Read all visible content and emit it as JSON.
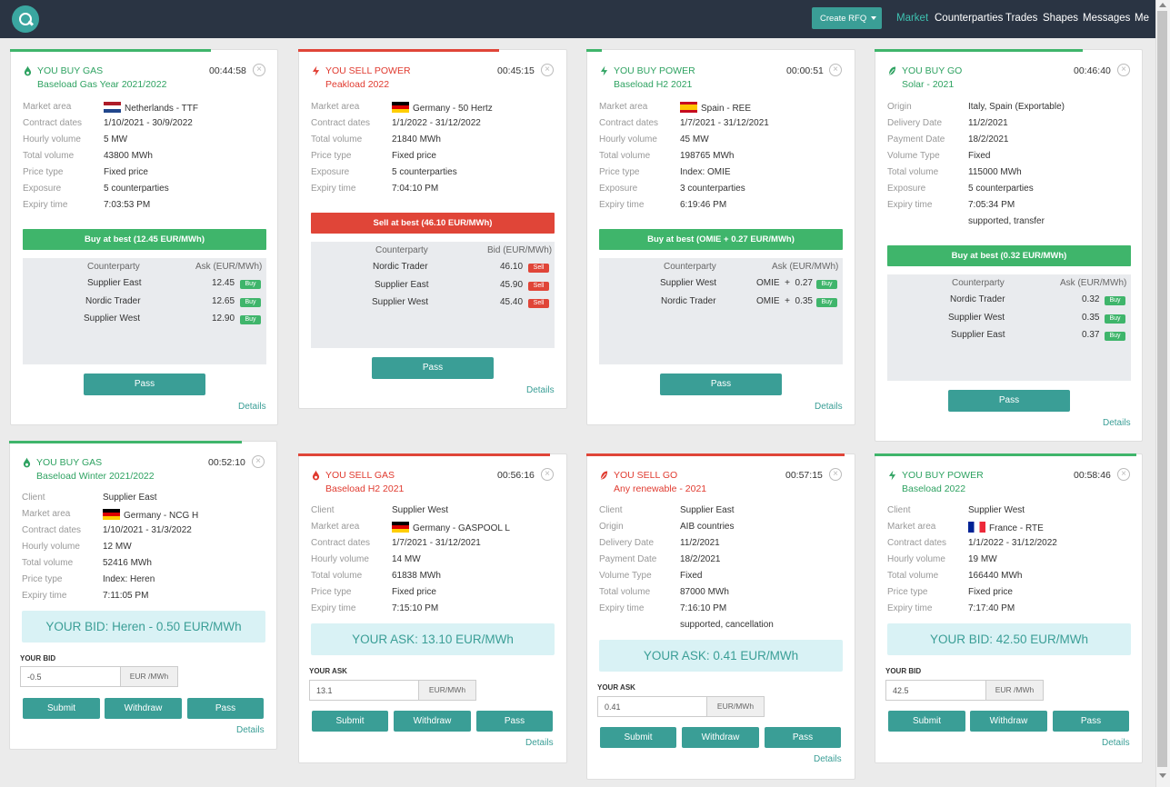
{
  "header": {
    "create_rfq": "Create RFQ",
    "nav": [
      "Market",
      "Counterparties",
      "Trades",
      "Shapes",
      "Messages",
      "Me"
    ]
  },
  "cards": {
    "c1": {
      "side": "YOU BUY GAS",
      "subtitle": "Baseload Gas Year 2021/2022",
      "timer": "00:44:58",
      "rows": [
        [
          "Market area",
          "Netherlands - TTF"
        ],
        [
          "Contract dates",
          "1/10/2021 - 30/9/2022"
        ],
        [
          "Hourly volume",
          "5 MW"
        ],
        [
          "Total volume",
          "43800 MWh"
        ],
        [
          "Price type",
          "Fixed price"
        ],
        [
          "Exposure",
          "5 counterparties"
        ],
        [
          "Expiry time",
          "7:03:53 PM"
        ]
      ],
      "best": "Buy at best (12.45 EUR/MWh)",
      "qh1": "Counterparty",
      "qh2": "Ask (EUR/MWh)",
      "quotes": [
        [
          "Supplier East",
          "12.45",
          "Buy"
        ],
        [
          "Nordic Trader",
          "12.65",
          "Buy"
        ],
        [
          "Supplier West",
          "12.90",
          "Buy"
        ]
      ],
      "pass": "Pass",
      "details": "Details"
    },
    "c2": {
      "side": "YOU SELL POWER",
      "subtitle": "Peakload 2022",
      "timer": "00:45:15",
      "rows": [
        [
          "Market area",
          "Germany - 50 Hertz"
        ],
        [
          "Contract dates",
          "1/1/2022 - 31/12/2022"
        ],
        [
          "Total volume",
          "21840 MWh"
        ],
        [
          "Price type",
          "Fixed price"
        ],
        [
          "Exposure",
          "5 counterparties"
        ],
        [
          "Expiry time",
          "7:04:10 PM"
        ]
      ],
      "best": "Sell at best (46.10 EUR/MWh)",
      "qh1": "Counterparty",
      "qh2": "Bid (EUR/MWh)",
      "quotes": [
        [
          "Nordic Trader",
          "46.10",
          "Sell"
        ],
        [
          "Supplier East",
          "45.90",
          "Sell"
        ],
        [
          "Supplier West",
          "45.40",
          "Sell"
        ]
      ],
      "pass": "Pass",
      "details": "Details"
    },
    "c3": {
      "side": "YOU BUY POWER",
      "subtitle": "Baseload H2 2021",
      "timer": "00:00:51",
      "rows": [
        [
          "Market area",
          "Spain - REE"
        ],
        [
          "Contract dates",
          "1/7/2021 - 31/12/2021"
        ],
        [
          "Hourly volume",
          "45 MW"
        ],
        [
          "Total volume",
          "198765 MWh"
        ],
        [
          "Price type",
          "Index: OMIE"
        ],
        [
          "Exposure",
          "3 counterparties"
        ],
        [
          "Expiry time",
          "6:19:46 PM"
        ]
      ],
      "best": "Buy at best (OMIE + 0.27 EUR/MWh)",
      "qh1": "Counterparty",
      "qh2": "Ask (EUR/MWh)",
      "quotes": [
        [
          "Supplier West",
          "OMIE  +  0.27",
          "Buy"
        ],
        [
          "Nordic Trader",
          "OMIE  +  0.35",
          "Buy"
        ]
      ],
      "pass": "Pass",
      "details": "Details"
    },
    "c4": {
      "side": "YOU BUY GO",
      "subtitle": "Solar - 2021",
      "timer": "00:46:40",
      "rows": [
        [
          "Origin",
          "Italy, Spain (Exportable)"
        ],
        [
          "Delivery Date",
          "11/2/2021"
        ],
        [
          "Payment Date",
          "18/2/2021"
        ],
        [
          "Volume Type",
          "Fixed"
        ],
        [
          "Total volume",
          "115000 MWh"
        ],
        [
          "Exposure",
          "5 counterparties"
        ],
        [
          "Expiry time",
          "7:05:34 PM"
        ]
      ],
      "extra": "supported, transfer",
      "best": "Buy at best (0.32 EUR/MWh)",
      "qh1": "Counterparty",
      "qh2": "Ask (EUR/MWh)",
      "quotes": [
        [
          "Nordic Trader",
          "0.32",
          "Buy"
        ],
        [
          "Supplier West",
          "0.35",
          "Buy"
        ],
        [
          "Supplier East",
          "0.37",
          "Buy"
        ]
      ],
      "pass": "Pass",
      "details": "Details"
    },
    "c5": {
      "side": "YOU BUY GAS",
      "subtitle": "Baseload Winter 2021/2022",
      "timer": "00:52:10",
      "rows": [
        [
          "Client",
          "Supplier East"
        ],
        [
          "Market area",
          "Germany - NCG H"
        ],
        [
          "Contract dates",
          "1/10/2021 - 31/3/2022"
        ],
        [
          "Hourly volume",
          "12 MW"
        ],
        [
          "Total volume",
          "52416 MWh"
        ],
        [
          "Price type",
          "Index: Heren"
        ],
        [
          "Expiry time",
          "7:11:05 PM"
        ]
      ],
      "yourbox": "YOUR BID: Heren - 0.50 EUR/MWh",
      "inlabel": "YOUR BID",
      "inval": "-0.5",
      "unit": "EUR /MWh",
      "submit": "Submit",
      "withdraw": "Withdraw",
      "pass": "Pass",
      "details": "Details"
    },
    "c6": {
      "side": "YOU SELL GAS",
      "subtitle": "Baseload H2 2021",
      "timer": "00:56:16",
      "rows": [
        [
          "Client",
          "Supplier West"
        ],
        [
          "Market area",
          "Germany - GASPOOL L"
        ],
        [
          "Contract dates",
          "1/7/2021 - 31/12/2021"
        ],
        [
          "Hourly volume",
          "14 MW"
        ],
        [
          "Total volume",
          "61838 MWh"
        ],
        [
          "Price type",
          "Fixed price"
        ],
        [
          "Expiry time",
          "7:15:10 PM"
        ]
      ],
      "yourbox": "YOUR ASK: 13.10 EUR/MWh",
      "inlabel": "YOUR ASK",
      "inval": "13.1",
      "unit": "EUR/MWh",
      "submit": "Submit",
      "withdraw": "Withdraw",
      "pass": "Pass",
      "details": "Details"
    },
    "c7": {
      "side": "YOU SELL GO",
      "subtitle": "Any renewable - 2021",
      "timer": "00:57:15",
      "rows": [
        [
          "Client",
          "Supplier East"
        ],
        [
          "Origin",
          "AIB countries"
        ],
        [
          "Delivery Date",
          "11/2/2021"
        ],
        [
          "Payment Date",
          "18/2/2021"
        ],
        [
          "Volume Type",
          "Fixed"
        ],
        [
          "Total volume",
          "87000 MWh"
        ],
        [
          "Expiry time",
          "7:16:10 PM"
        ]
      ],
      "extra": "supported, cancellation",
      "yourbox": "YOUR ASK: 0.41 EUR/MWh",
      "inlabel": "YOUR ASK",
      "inval": "0.41",
      "unit": "EUR/MWh",
      "submit": "Submit",
      "withdraw": "Withdraw",
      "pass": "Pass",
      "details": "Details"
    },
    "c8": {
      "side": "YOU BUY POWER",
      "subtitle": "Baseload 2022",
      "timer": "00:58:46",
      "rows": [
        [
          "Client",
          "Supplier West"
        ],
        [
          "Market area",
          "France - RTE"
        ],
        [
          "Contract dates",
          "1/1/2022 - 31/12/2022"
        ],
        [
          "Hourly volume",
          "19 MW"
        ],
        [
          "Total volume",
          "166440 MWh"
        ],
        [
          "Price type",
          "Fixed price"
        ],
        [
          "Expiry time",
          "7:17:40 PM"
        ]
      ],
      "yourbox": "YOUR BID: 42.50 EUR/MWh",
      "inlabel": "YOUR BID",
      "inval": "42.5",
      "unit": "EUR /MWh",
      "submit": "Submit",
      "withdraw": "Withdraw",
      "pass": "Pass",
      "details": "Details"
    }
  }
}
